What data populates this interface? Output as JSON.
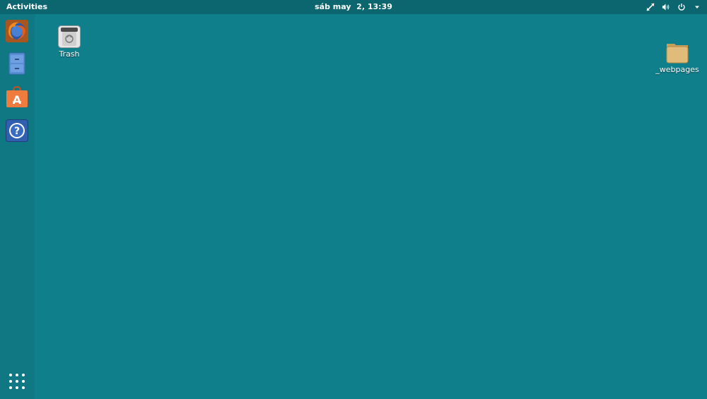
{
  "topbar": {
    "activities_label": "Activities",
    "clock": "sáb may  2, 13:39",
    "tray_icons": [
      "network-icon",
      "volume-icon",
      "power-icon",
      "chevron-down-icon"
    ]
  },
  "dock": {
    "items": [
      {
        "name": "firefox",
        "icon": "firefox-icon"
      },
      {
        "name": "files",
        "icon": "file-cabinet-icon"
      },
      {
        "name": "software",
        "icon": "shopping-bag-icon"
      },
      {
        "name": "help",
        "icon": "help-icon"
      }
    ],
    "show_apps_icon": "app-grid-icon"
  },
  "desktop": {
    "trash_label": "Trash",
    "folder_label": "_webpages"
  },
  "colors": {
    "background": "#0f7f8c",
    "topbar": "#0c6670",
    "dock": "#107883"
  }
}
